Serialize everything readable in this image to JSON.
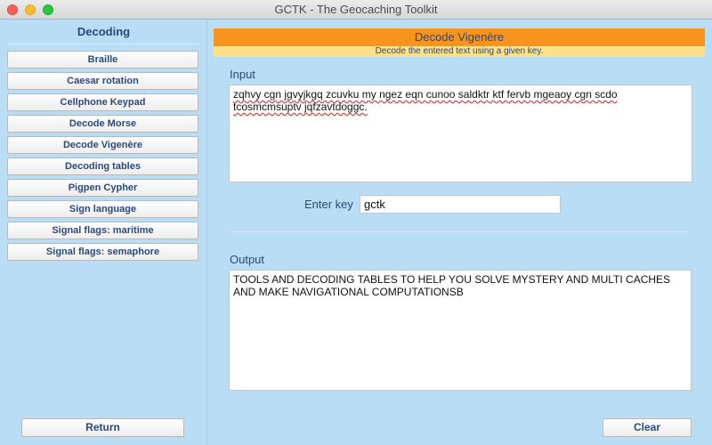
{
  "window": {
    "title": "GCTK - The Geocaching Toolkit"
  },
  "sidebar": {
    "title": "Decoding",
    "items": [
      {
        "label": "Braille"
      },
      {
        "label": "Caesar rotation"
      },
      {
        "label": "Cellphone Keypad"
      },
      {
        "label": "Decode Morse"
      },
      {
        "label": "Decode Vigenère"
      },
      {
        "label": "Decoding tables"
      },
      {
        "label": "Pigpen Cypher"
      },
      {
        "label": "Sign language"
      },
      {
        "label": "Signal flags: maritime"
      },
      {
        "label": "Signal flags: semaphore"
      }
    ],
    "return_label": "Return"
  },
  "main": {
    "banner_title": "Decode Vigenère",
    "banner_subtitle": "Decode the entered text using a given key.",
    "input_label": "Input",
    "input_text": "zqhvy cgn jgvyjkgq zcuvku my ngez eqn cunoo saldktr ktf fervb mgeaoy cgn scdo tcosmcmsuptv jqfzavtdoggc.",
    "key_label": "Enter key",
    "key_value": "gctk",
    "output_label": "Output",
    "output_text": "TOOLS AND DECODING TABLES TO HELP YOU SOLVE MYSTERY AND MULTI CACHES AND MAKE NAVIGATIONAL COMPUTATIONSB",
    "clear_label": "Clear"
  },
  "colors": {
    "background": "#b9ddf5",
    "banner": "#f7941d",
    "subbanner": "#fde08a",
    "text_accent": "#2a4a7a"
  }
}
